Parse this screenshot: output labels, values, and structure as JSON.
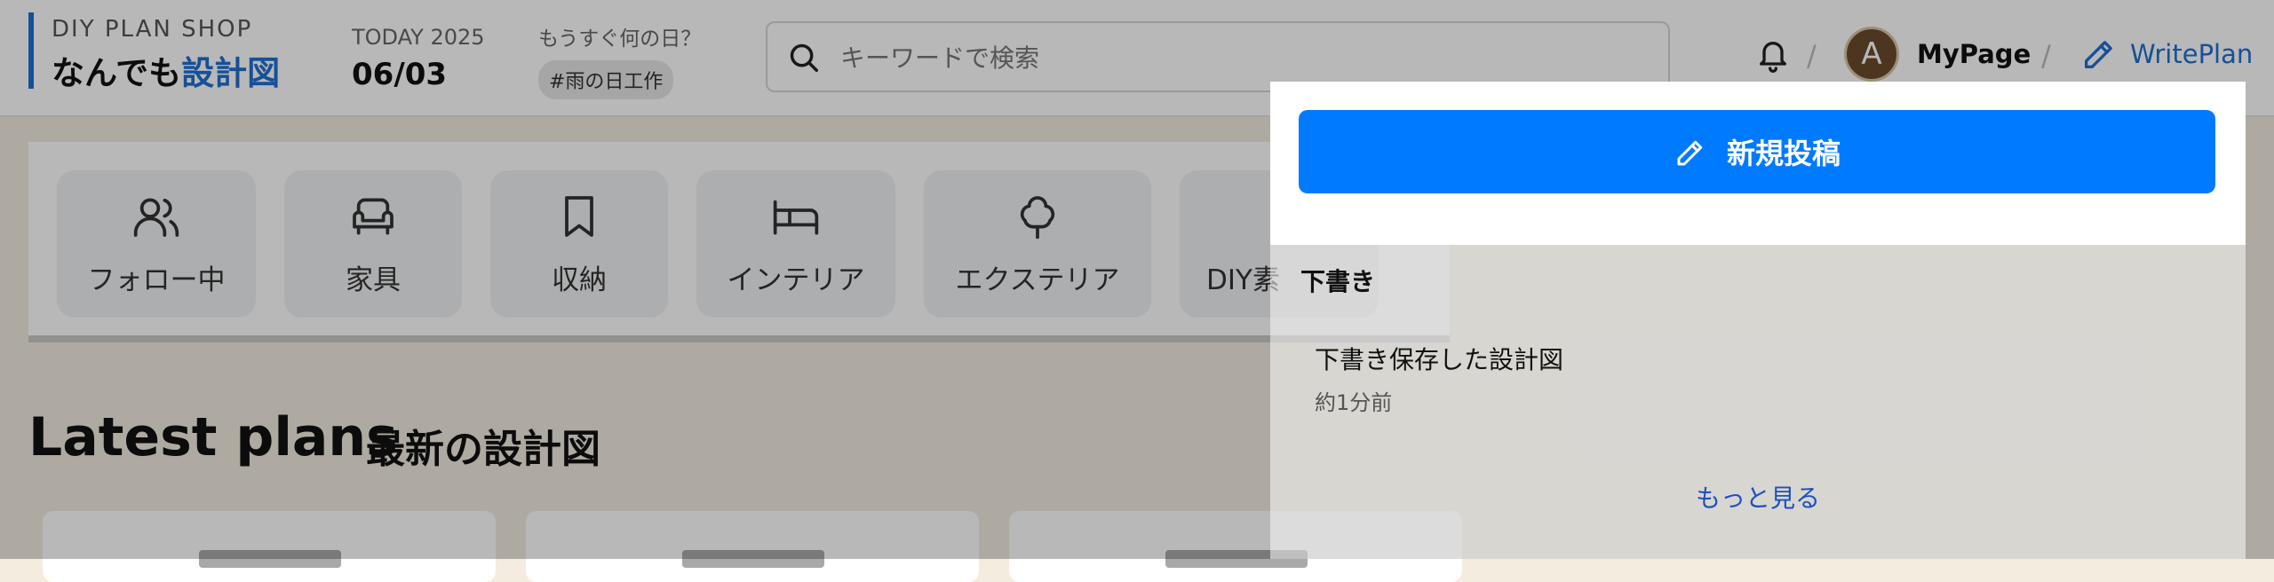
{
  "header": {
    "brand_small": "DIY PLAN SHOP",
    "brand_title_plain": "なんでも",
    "brand_title_accent": "設計図",
    "today_label": "TODAY 2025",
    "today_date": "06/03",
    "rainy_question": "もうすぐ何の日？",
    "rainy_tag": "#雨の日工作",
    "search_placeholder": "キーワードで検索",
    "separator": "/",
    "avatar_letter": "A",
    "mypage_label": "MyPage",
    "writeplan_label": "WritePlan",
    "accent_color": "#1f6fd1"
  },
  "categories": [
    {
      "label": "フォロー中",
      "icon": "users-icon"
    },
    {
      "label": "家具",
      "icon": "sofa-icon"
    },
    {
      "label": "収納",
      "icon": "bookmark-icon"
    },
    {
      "label": "インテリア",
      "icon": "bed-icon"
    },
    {
      "label": "エクステリア",
      "icon": "tree-icon"
    },
    {
      "label": "DIY素",
      "icon": "material-icon"
    }
  ],
  "latest": {
    "title": "Latest plans",
    "subtitle": "最新の設計図"
  },
  "dropdown": {
    "new_post_label": "新規投稿",
    "new_post_color": "#007aff",
    "drafts_heading": "下書き",
    "drafts": [
      {
        "title": "下書き保存した設計図",
        "time": "約1分前"
      }
    ],
    "more_label": "もっと見る"
  }
}
